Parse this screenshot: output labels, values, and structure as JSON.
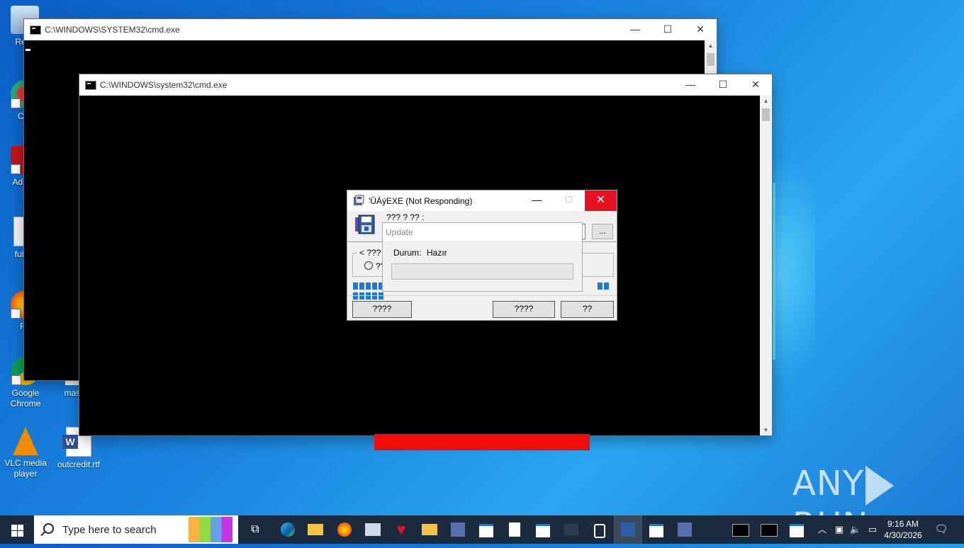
{
  "desktop": {
    "icons": [
      {
        "label": "Recy"
      },
      {
        "label": "CCl"
      },
      {
        "label": "Ad Acr"
      },
      {
        "label": "fullpri"
      },
      {
        "label": "Fir"
      },
      {
        "label": "Google Chrome"
      },
      {
        "label": "maste"
      },
      {
        "label": "VLC media player"
      },
      {
        "label": "outcredit.rtf"
      }
    ]
  },
  "cmd_back": {
    "title": "C:\\WINDOWS\\SYSTEM32\\cmd.exe"
  },
  "cmd_front": {
    "title": "C:\\WINDOWS\\system32\\cmd.exe"
  },
  "caption": {
    "minimize": "—",
    "maximize": "☐",
    "close": "✕"
  },
  "installer": {
    "title": "'ÜÁýEXE (Not Responding)",
    "prompt": "??? ? ?? :",
    "browse_label": "...",
    "group_label": "< ???",
    "radio_label": "??",
    "progress_segments": 7,
    "buttons": {
      "left": "????",
      "middle": "????",
      "right": "??"
    }
  },
  "update_dialog": {
    "title": "Update",
    "status_label": "Durum:",
    "status_value": "Hazır",
    "progress": 0
  },
  "watermark": {
    "left": "ANY",
    "right": "RUN"
  },
  "taskbar": {
    "search_placeholder": "Type here to search",
    "time": "9:16 AM",
    "date": "4/30/2026"
  },
  "colors": {
    "close_red": "#e81123",
    "progress_blue": "#1e7ad0",
    "red_bar": "#f10b0b",
    "taskbar": "#1c2b3d"
  }
}
